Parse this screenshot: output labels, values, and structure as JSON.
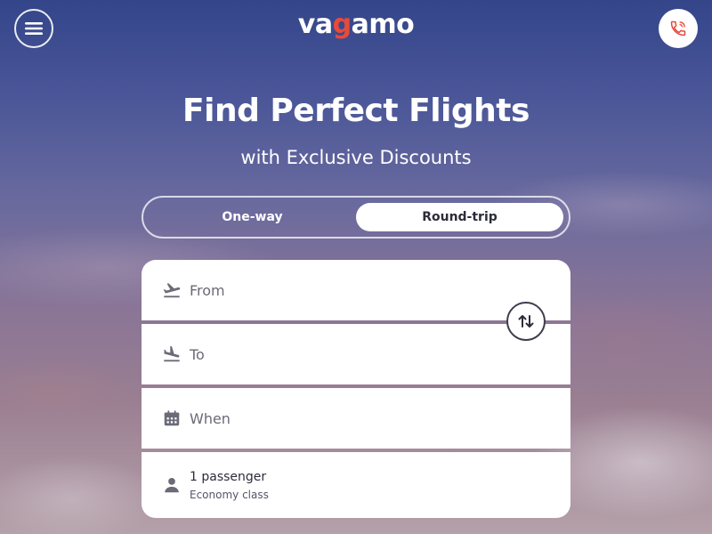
{
  "header": {
    "logo_prefix": "va",
    "logo_accent": "g",
    "logo_suffix": "amo",
    "menu_icon": "hamburger-menu-icon",
    "call_icon": "phone-icon"
  },
  "hero": {
    "title": "Find Perfect Flights",
    "subtitle": "with Exclusive Discounts"
  },
  "trip_type": {
    "options": [
      "One-way",
      "Round-trip"
    ],
    "selected": "Round-trip"
  },
  "search_form": {
    "from_label": "From",
    "to_label": "To",
    "when_label": "When",
    "passengers": "1 passenger",
    "cabin_class": "Economy class",
    "swap_icon": "swap-arrows-icon"
  },
  "colors": {
    "accent": "#e84a3a",
    "text_dark": "#2c2c3a",
    "icon_gray": "#6b6b78",
    "white": "#ffffff"
  }
}
